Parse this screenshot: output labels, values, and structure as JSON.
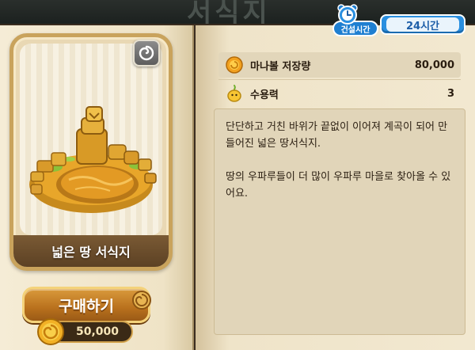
{
  "banner": {
    "title": "서식지"
  },
  "habitat": {
    "name": "넓은 땅 서식지",
    "description": [
      "단단하고 거친 바위가 끝없이 이어져 계곡이 되어 만들어진 넓은 땅서식지.",
      "땅의 우파루들이 더 많이 우파루 마을로 찾아올 수 있어요."
    ]
  },
  "build_time": {
    "label": "건설시간",
    "value": "24시간"
  },
  "stats": [
    {
      "icon": "mana-ball-icon",
      "label": "마나볼 저장량",
      "value": "80,000"
    },
    {
      "icon": "capacity-icon",
      "label": "수용력",
      "value": "3"
    }
  ],
  "purchase": {
    "button_label": "구매하기",
    "price": "50,000",
    "currency_icon": "gold-coin-icon"
  },
  "colors": {
    "accent": "#c9a35c",
    "build_time_blue": "#2a8fe0",
    "button": "#b9711d"
  }
}
